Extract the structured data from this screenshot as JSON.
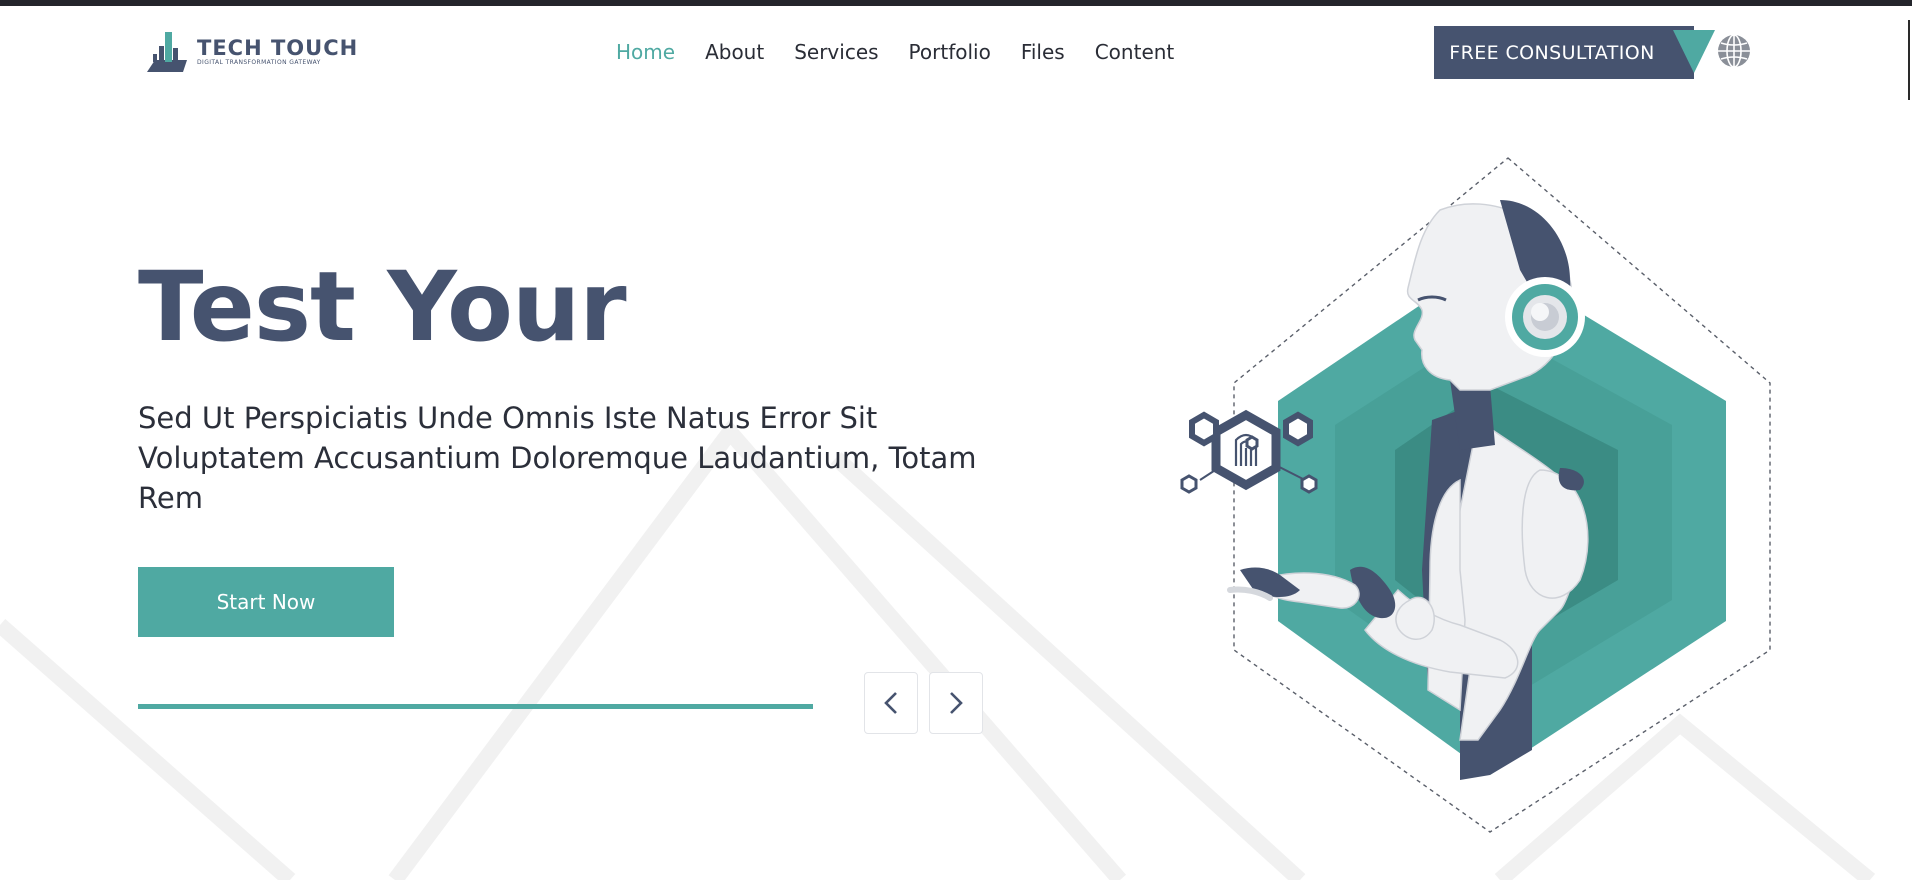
{
  "brand": {
    "name": "TECH TOUCH",
    "tagline": "DIGITAL TRANSFORMATION GATEWAY"
  },
  "nav": {
    "items": [
      {
        "label": "Home",
        "active": true
      },
      {
        "label": "About",
        "active": false
      },
      {
        "label": "Services",
        "active": false
      },
      {
        "label": "Portfolio",
        "active": false
      },
      {
        "label": "Files",
        "active": false
      },
      {
        "label": "Content",
        "active": false
      }
    ]
  },
  "header": {
    "cta_label": "FREE CONSULTATION",
    "language_icon": "globe-icon"
  },
  "hero": {
    "title": "Test Your",
    "subtitle": "Sed Ut Perspiciatis Unde Omnis Iste Natus Error Sit Voluptatem Accusantium Doloremque Laudantium, Totam Rem",
    "button_label": "Start Now",
    "slider_progress": 1.0,
    "prev_icon": "chevron-left-icon",
    "next_icon": "chevron-right-icon"
  },
  "colors": {
    "primary": "#46536f",
    "accent": "#4fa9a2",
    "accent_dark": "#3b8c84",
    "text": "#2b2f3a",
    "robot_body": "#f0f1f3"
  }
}
